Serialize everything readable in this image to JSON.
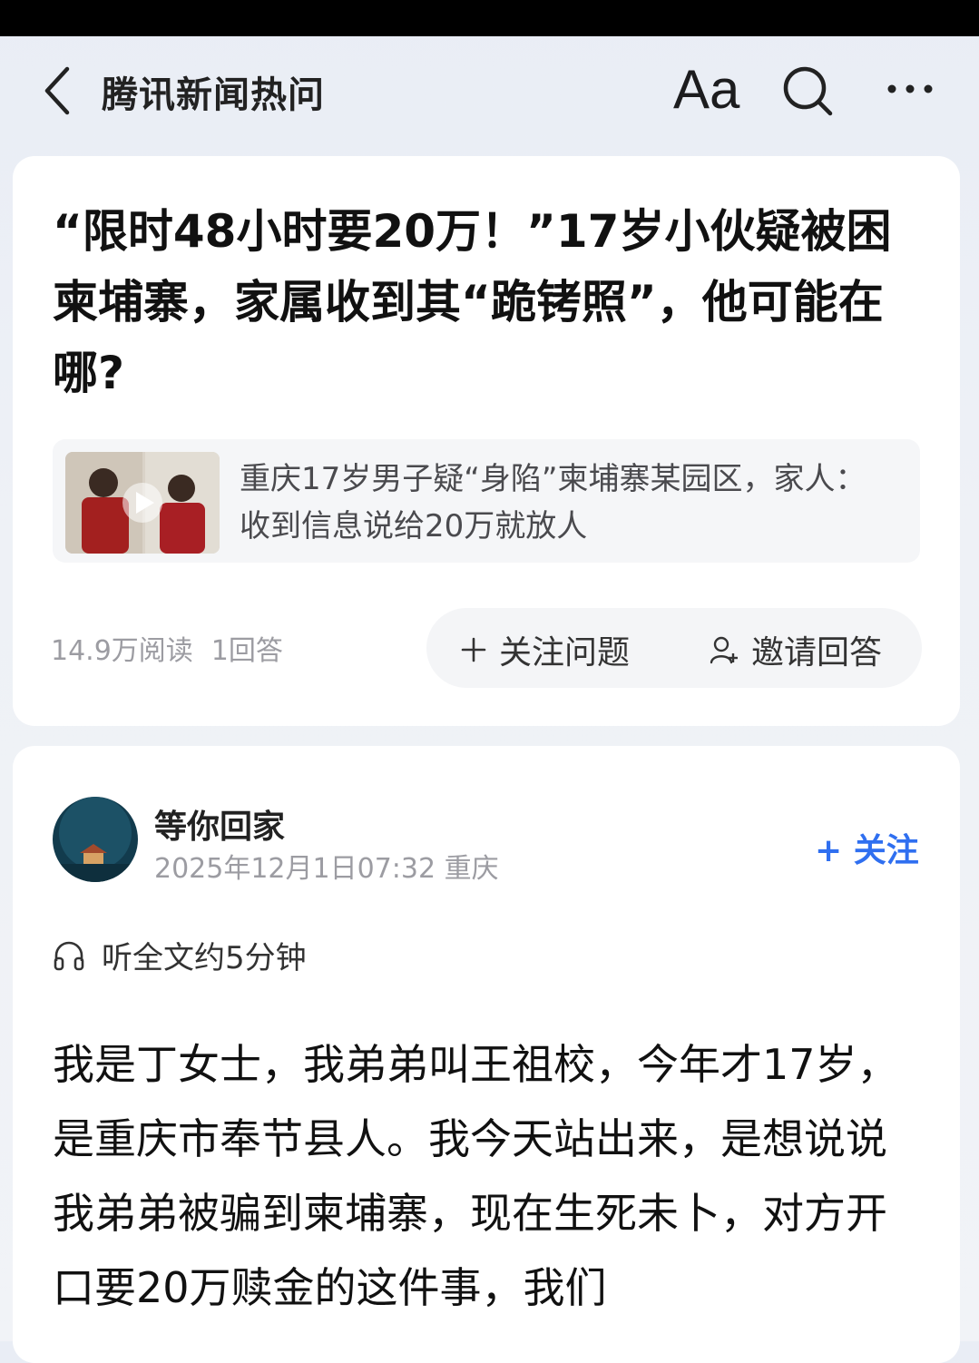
{
  "nav": {
    "title": "腾讯新闻热问",
    "font_size_label": "Aa",
    "icons": [
      "back-icon",
      "font-size-icon",
      "search-icon",
      "more-icon"
    ]
  },
  "question": {
    "title": "“限时48小时要20万！”17岁小伙疑被困柬埔寨，家属收到其“跪铐照”，他可能在哪?",
    "news_link": {
      "text": "重庆17岁男子疑“身陷”柬埔寨某园区，家人：收到信息说给20万就放人",
      "thumb_icon": "play-icon"
    },
    "stats": {
      "reads": "14.9万阅读",
      "answers": "1回答"
    },
    "actions": {
      "follow_label": "关注问题",
      "invite_label": "邀请回答"
    }
  },
  "answer": {
    "author": "等你回家",
    "meta": "2025年12月1日07:32 重庆",
    "follow_label": "+ 关注",
    "listen_label": "听全文约5分钟",
    "body": "我是丁女士，我弟弟叫王祖校，今年才17岁，是重庆市奉节县人。我今天站出来，是想说说我弟弟被骗到柬埔寨，现在生死未卜，对方开口要20万赎金的这件事，我们"
  },
  "colors": {
    "accent": "#2f6ff0",
    "background": "#eef1f6",
    "card": "#ffffff",
    "muted_text": "#9c9ca2"
  }
}
